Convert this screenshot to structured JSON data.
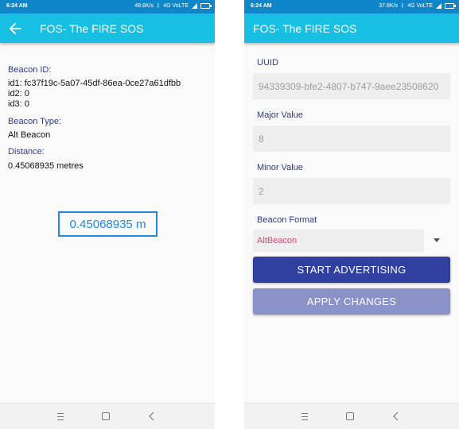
{
  "left": {
    "status": {
      "time": "6:24 AM",
      "rate": "48.8K/s",
      "network": "4G VoLTE"
    },
    "title": "FOS- The FIRE SOS",
    "beacon_id_label": "Beacon ID:",
    "id1": "id1: fc37f19c-5a07-45df-86ea-0ce27a61dfbb",
    "id2": "id2: 0",
    "id3": "id3: 0",
    "beacon_type_label": "Beacon Type:",
    "beacon_type": "Alt Beacon",
    "distance_label": "Distance:",
    "distance": "0.45068935 metres",
    "distance_box": "0.45068935 m"
  },
  "right": {
    "status": {
      "time": "6:24 AM",
      "rate": "37.8K/s",
      "network": "4G VoLTE"
    },
    "title": "FOS- The FIRE SOS",
    "uuid_label": "UUID",
    "uuid_value": "94339309-bfe2-4807-b747-9aee23508620",
    "major_label": "Major Value",
    "major_value": "8",
    "minor_label": "Minor Value",
    "minor_value": "2",
    "format_label": "Beacon Format",
    "format_selected": "AltBeacon",
    "start_button": "START ADVERTISING",
    "apply_button": "APPLY CHANGES"
  },
  "colors": {
    "status_bar": "#0f86c9",
    "app_bar": "#17bfe3",
    "label": "#2e3a8c",
    "start_button": "#313f9e",
    "apply_button": "#8a92c8",
    "distance_box": "#1e88e5",
    "select_text": "#e5436d"
  },
  "icons": [
    "back-arrow-icon",
    "bluetooth-icon",
    "signal-icon",
    "battery-icon",
    "menu-icon",
    "home-icon",
    "nav-back-icon",
    "dropdown-arrow-icon"
  ]
}
